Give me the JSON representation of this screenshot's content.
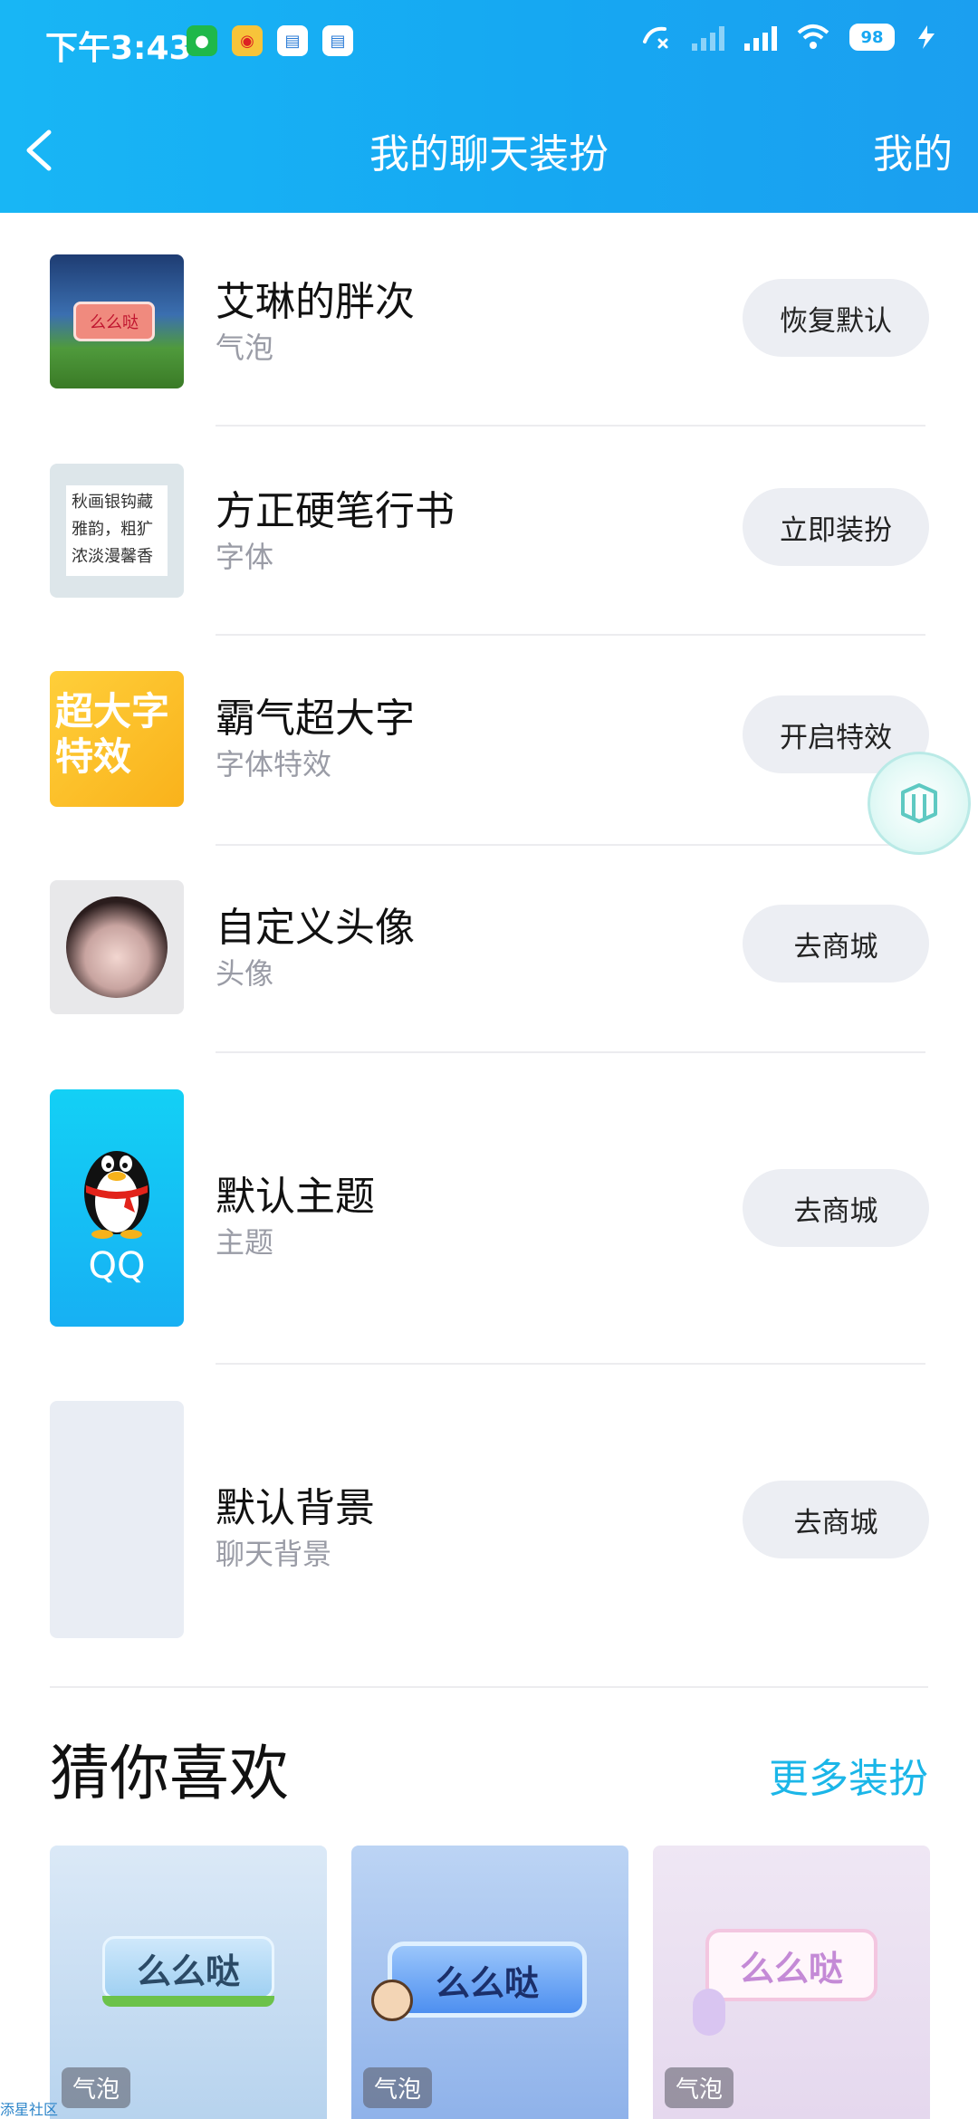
{
  "status_bar": {
    "time": "下午3:43",
    "battery": "98"
  },
  "nav": {
    "title": "我的聊天装扮",
    "right_label": "我的"
  },
  "items": [
    {
      "title": "艾琳的胖次",
      "subtitle": "气泡",
      "button": "恢复默认",
      "thumb_text": "么么哒"
    },
    {
      "title": "方正硬笔行书",
      "subtitle": "字体",
      "button": "立即装扮",
      "thumb_text": "秋画银钩藏雅韵，粗犷浓淡漫馨香"
    },
    {
      "title": "霸气超大字",
      "subtitle": "字体特效",
      "button": "开启特效",
      "thumb_text": "超大字特效"
    },
    {
      "title": "自定义头像",
      "subtitle": "头像",
      "button": "去商城"
    },
    {
      "title": "默认主题",
      "subtitle": "主题",
      "button": "去商城",
      "thumb_text": "QQ"
    },
    {
      "title": "默认背景",
      "subtitle": "聊天背景",
      "button": "去商城"
    }
  ],
  "recommend": {
    "title": "猜你喜欢",
    "more": "更多装扮",
    "cards": [
      {
        "bubble_text": "么么哒",
        "label": "气泡"
      },
      {
        "bubble_text": "么么哒",
        "label": "气泡"
      },
      {
        "bubble_text": "么么哒",
        "label": "气泡"
      }
    ]
  },
  "footer_mark": "添星社区"
}
